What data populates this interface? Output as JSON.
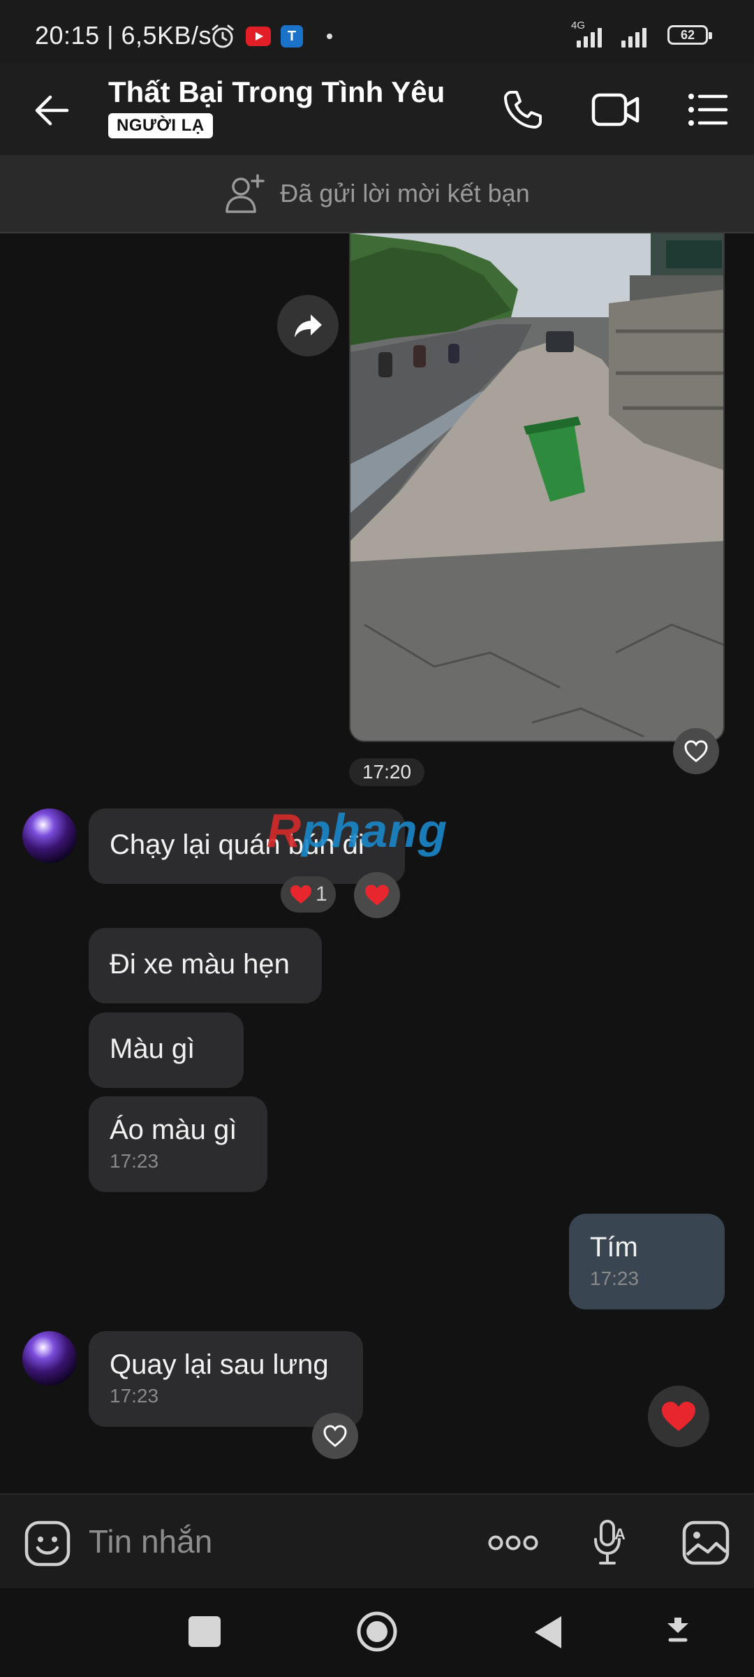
{
  "status_bar": {
    "time_speed": "20:15 | 6,5KB/s",
    "network": "4G",
    "battery": "62"
  },
  "header": {
    "title": "Thất Bại Trong Tình Yêu",
    "badge": "NGƯỜI LẠ",
    "back_icon": "back-arrow-icon",
    "call_icon": "phone-icon",
    "video_icon": "video-camera-icon",
    "menu_icon": "list-menu-icon"
  },
  "banner": {
    "text": "Đã gửi lời mời kết bạn",
    "icon": "add-friend-icon"
  },
  "messages": {
    "photo_time": "17:20",
    "m1": {
      "text": "Chạy lại quán bún đi",
      "reaction_count": "1"
    },
    "m2": {
      "text": "Đi xe màu hẹn"
    },
    "m3": {
      "text": "Màu gì"
    },
    "m4": {
      "text": "Áo màu gì",
      "time": "17:23"
    },
    "m5": {
      "text": "Tím",
      "time": "17:23"
    },
    "m6": {
      "text": "Quay lại sau lưng",
      "time": "17:23"
    }
  },
  "watermark": {
    "part1": "R",
    "part2": "phang"
  },
  "composer": {
    "placeholder": "Tin nhắn",
    "sticker_icon": "sticker-icon",
    "more_icon": "more-dots-icon",
    "mic_icon": "voice-to-text-icon",
    "gallery_icon": "gallery-icon"
  },
  "colors": {
    "background": "#121212",
    "incoming_bubble": "#2c2c2e",
    "outgoing_bubble": "#3a4552",
    "heart": "#e8262d",
    "watermark_blue": "#1a87c9",
    "watermark_red": "#d52a2a"
  }
}
